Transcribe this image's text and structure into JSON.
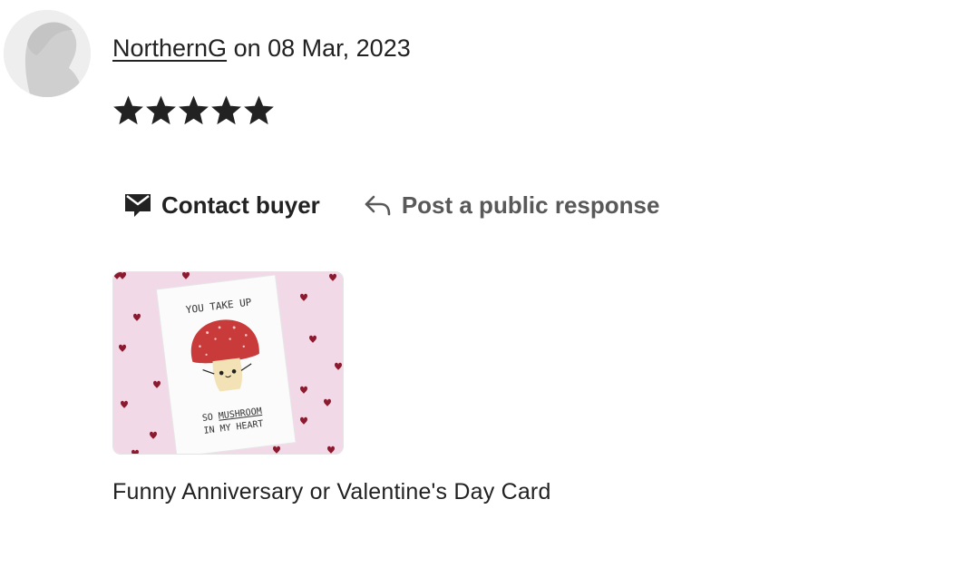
{
  "review": {
    "username": "NorthernG",
    "date_text": "on 08 Mar, 2023",
    "rating": 5,
    "rating_max": 5
  },
  "actions": {
    "contact_label": "Contact buyer",
    "respond_label": "Post a public response"
  },
  "product": {
    "image_lines": {
      "top": "YOU TAKE UP",
      "bottom_prefix": "SO",
      "bottom_underlined": "MUSHROOM",
      "bottom_line2": "IN MY HEART"
    },
    "title": "Funny Anniversary or Valentine's Day Card"
  },
  "icons": {
    "avatar": "default-user-silhouette-icon",
    "star": "star-filled-icon",
    "contact": "mail-speech-bubble-icon",
    "respond": "reply-arrow-icon"
  },
  "colors": {
    "text": "#222222",
    "muted_text": "#595959",
    "star": "#222222",
    "card_background": "#f1d9e8",
    "heart": "#8b1a2e",
    "mushroom_cap": "#c93a3a"
  }
}
